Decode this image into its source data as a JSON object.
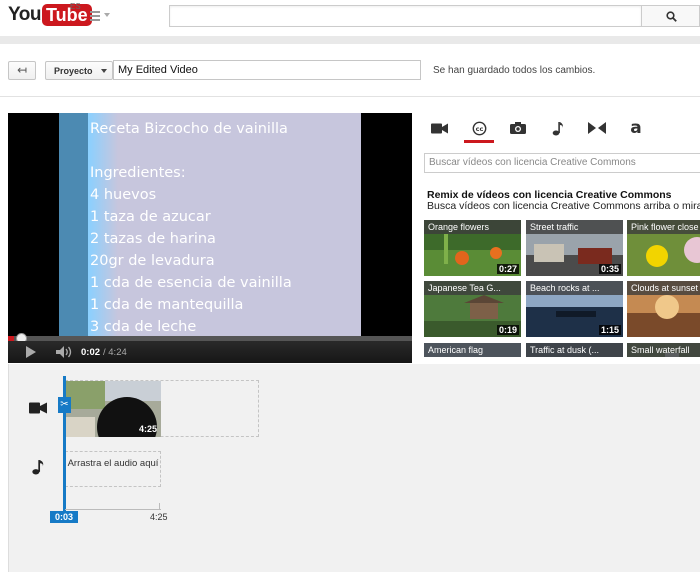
{
  "header": {
    "logo_you": "You",
    "logo_tube": "Tube",
    "logo_region": "ES",
    "search_placeholder": ""
  },
  "project_bar": {
    "project_label": "Proyecto",
    "title_value": "My Edited Video",
    "saved_status": "Se han guardado todos los cambios."
  },
  "player": {
    "slide_lines": [
      "Receta Bizcocho de vainilla",
      "",
      "Ingredientes:",
      "4 huevos",
      "1 taza de azucar",
      "2 tazas de harina",
      "20gr de levadura",
      "1 cda de esencia de vainilla",
      "1 cda de mantequilla",
      "3 cda de leche"
    ],
    "current_time": "0:02",
    "duration": "/ 4:24",
    "progress_fraction": 0.008
  },
  "panel": {
    "tabs": [
      {
        "icon": "video-camera-icon",
        "active": false
      },
      {
        "icon": "creative-commons-icon",
        "active": true
      },
      {
        "icon": "photo-camera-icon",
        "active": false
      },
      {
        "icon": "music-note-icon",
        "active": false
      },
      {
        "icon": "transitions-icon",
        "active": false
      },
      {
        "icon": "text-icon",
        "active": false
      }
    ],
    "search_placeholder": "Buscar vídeos con licencia Creative Commons",
    "remix_title": "Remix de vídeos con licencia Creative Commons",
    "remix_subtitle": "Busca vídeos con licencia Creative Commons arriba o mira",
    "thumbnails": [
      {
        "title": "Orange flowers",
        "duration": "0:27"
      },
      {
        "title": "Street traffic",
        "duration": "0:35"
      },
      {
        "title": "Pink flower close",
        "duration": ""
      },
      {
        "title": "Japanese Tea G...",
        "duration": "0:19"
      },
      {
        "title": "Beach rocks at ...",
        "duration": "1:15"
      },
      {
        "title": "Clouds at sunset",
        "duration": ""
      },
      {
        "title": "American flag",
        "duration": ""
      },
      {
        "title": "Traffic at dusk (...",
        "duration": ""
      },
      {
        "title": "Small waterfall",
        "duration": ""
      }
    ]
  },
  "timeline": {
    "clip_duration": "4:25",
    "audio_drop_text": "Arrastra el audio aquí",
    "playhead_time": "0:03",
    "end_time": "4:25"
  },
  "colors": {
    "accent_red": "#cc181e",
    "timeline_blue": "#167ac6"
  }
}
